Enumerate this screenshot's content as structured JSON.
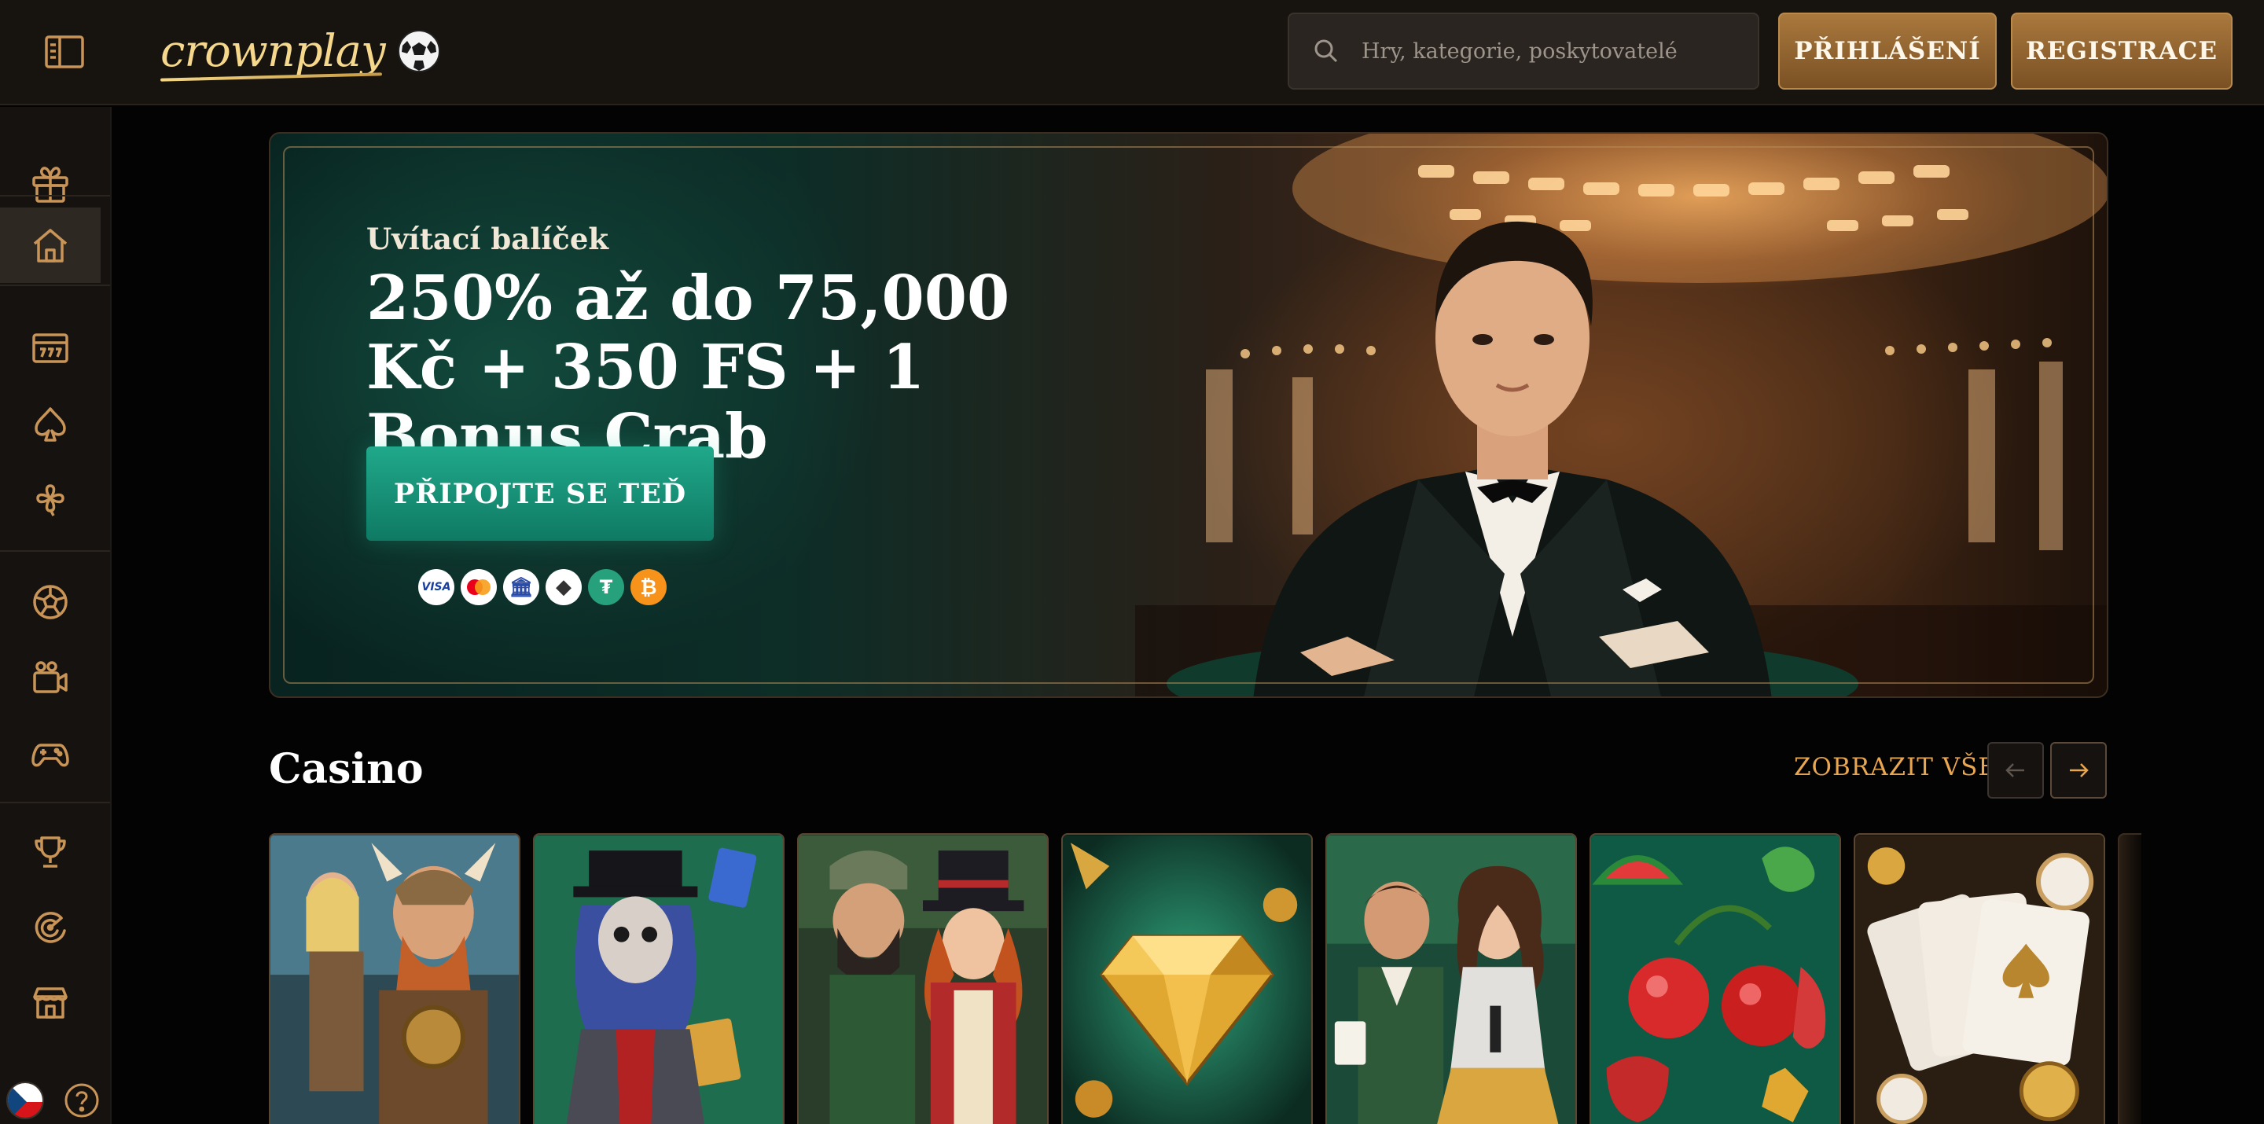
{
  "header": {
    "logo_text": "crownplay",
    "search_placeholder": "Hry, kategorie, poskytovatelé",
    "login_label": "PŘIHLÁŠENÍ",
    "register_label": "REGISTRACE"
  },
  "sidebar": {
    "items": [
      {
        "icon": "gift-icon"
      },
      {
        "icon": "home-icon",
        "active": true
      },
      {
        "icon": "slot-machine-icon"
      },
      {
        "icon": "spade-icon"
      },
      {
        "icon": "clover-icon"
      },
      {
        "icon": "sports-ball-icon"
      },
      {
        "icon": "live-camera-icon"
      },
      {
        "icon": "gamepad-icon"
      },
      {
        "icon": "trophy-icon"
      },
      {
        "icon": "wheel-icon"
      },
      {
        "icon": "shop-icon"
      }
    ],
    "language_flag": "cz-flag-icon",
    "help_icon": "help-icon"
  },
  "banner": {
    "subtitle": "Uvítací balíček",
    "title": "250% až do 75,000 Kč + 350 FS + 1 Bonus Crab",
    "cta_label": "PŘIPOJTE SE TEĎ",
    "payment_methods": [
      "visa",
      "mastercard",
      "bank",
      "ethereum",
      "tether",
      "bitcoin"
    ],
    "pay_visa_text": "VISA",
    "pay_bank_glyph": "🏛",
    "pay_eth_glyph": "◆",
    "pay_tether_glyph": "₮",
    "pay_btc_glyph": "₿"
  },
  "casino": {
    "title": "Casino",
    "view_all_label": "ZOBRAZIT VŠE",
    "games": [
      {
        "theme": "viking-warriors"
      },
      {
        "theme": "voodoo-magician"
      },
      {
        "theme": "gnome-and-ringmaster"
      },
      {
        "theme": "golden-diamond"
      },
      {
        "theme": "live-casino-hosts"
      },
      {
        "theme": "fruit-slots"
      },
      {
        "theme": "poker-cards-chips"
      }
    ]
  },
  "colors": {
    "accent_gold": "#e9a650",
    "button_gold": "#a9783d",
    "cta_green": "#20a88a",
    "background": "#030303",
    "header_bg": "#17130f"
  }
}
